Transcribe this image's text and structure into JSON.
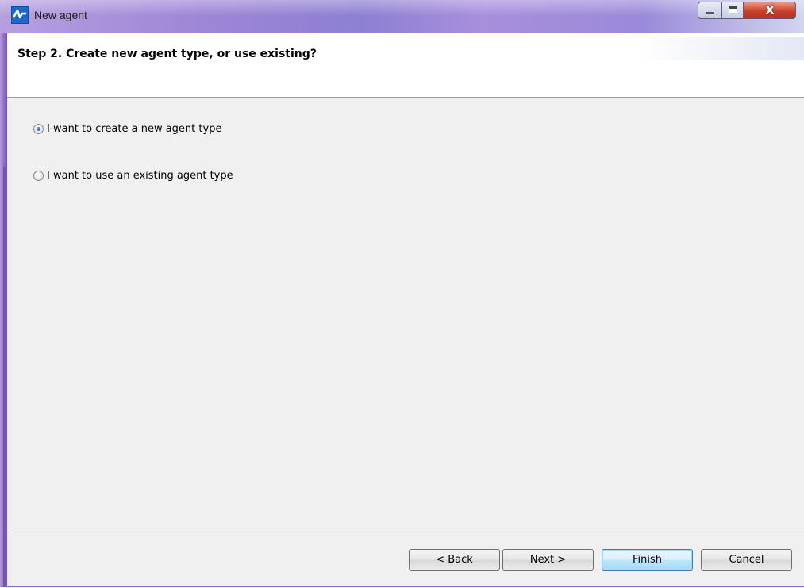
{
  "window": {
    "title": "New agent",
    "controls": {
      "minimize": "minimize",
      "maximize": "maximize",
      "close": "X"
    }
  },
  "header": {
    "step_title": "Step 2. Create new agent type, or use existing?"
  },
  "options": [
    {
      "label": "I want to create a new agent type",
      "selected": true
    },
    {
      "label": "I want to use an existing agent type",
      "selected": false
    }
  ],
  "footer": {
    "back_label": "< Back",
    "next_label": "Next >",
    "finish_label": "Finish",
    "cancel_label": "Cancel"
  },
  "colors": {
    "accent": "#1f67c9",
    "body_bg": "#f0f0f0",
    "close_red": "#c9402a"
  }
}
